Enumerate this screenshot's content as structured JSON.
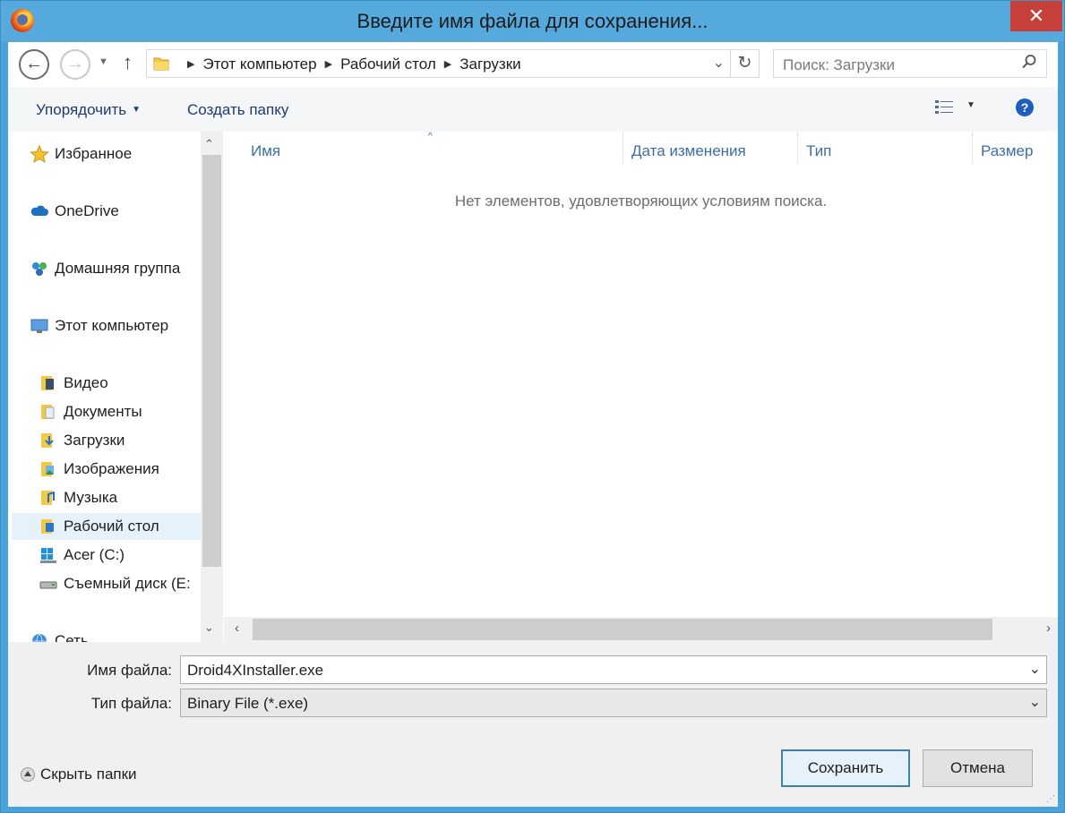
{
  "window": {
    "title": "Введите имя файла для сохранения...",
    "close_glyph": "✕"
  },
  "nav": {
    "back_glyph": "←",
    "forward_glyph": "→",
    "up_glyph": "↑",
    "breadcrumbs": [
      "Этот компьютер",
      "Рабочий стол",
      "Загрузки"
    ],
    "search_placeholder": "Поиск: Загрузки"
  },
  "toolbar": {
    "organize_label": "Упорядочить",
    "new_folder_label": "Создать папку",
    "help_glyph": "?"
  },
  "sidebar": {
    "items": [
      {
        "label": "Избранное",
        "icon": "star-icon"
      },
      {
        "label": "OneDrive",
        "icon": "cloud-icon"
      },
      {
        "label": "Домашняя группа",
        "icon": "homegroup-icon"
      },
      {
        "label": "Этот компьютер",
        "icon": "computer-icon"
      },
      {
        "label": "Видео",
        "icon": "video-folder-icon"
      },
      {
        "label": "Документы",
        "icon": "documents-folder-icon"
      },
      {
        "label": "Загрузки",
        "icon": "downloads-folder-icon"
      },
      {
        "label": "Изображения",
        "icon": "pictures-folder-icon"
      },
      {
        "label": "Музыка",
        "icon": "music-folder-icon"
      },
      {
        "label": "Рабочий стол",
        "icon": "desktop-folder-icon",
        "selected": true
      },
      {
        "label": "Acer (C:)",
        "icon": "windows-drive-icon"
      },
      {
        "label": "Съемный диск (E:",
        "icon": "removable-drive-icon"
      },
      {
        "label": "Сеть",
        "icon": "network-icon"
      }
    ]
  },
  "filelist": {
    "columns": [
      "Имя",
      "Дата изменения",
      "Тип",
      "Размер"
    ],
    "empty_message": "Нет элементов, удовлетворяющих условиям поиска."
  },
  "form": {
    "filename_label": "Имя файла:",
    "filename_value": "Droid4XInstaller.exe",
    "filetype_label": "Тип файла:",
    "filetype_value": "Binary File (*.exe)",
    "hide_folders_label": "Скрыть папки",
    "save_label": "Сохранить",
    "cancel_label": "Отмена"
  },
  "colors": {
    "titlebar": "#56a9dc",
    "close_button": "#c8403a",
    "link_text": "#1e3c6e",
    "column_header": "#3c6ea5",
    "selected_item": "#e5f1fb"
  }
}
